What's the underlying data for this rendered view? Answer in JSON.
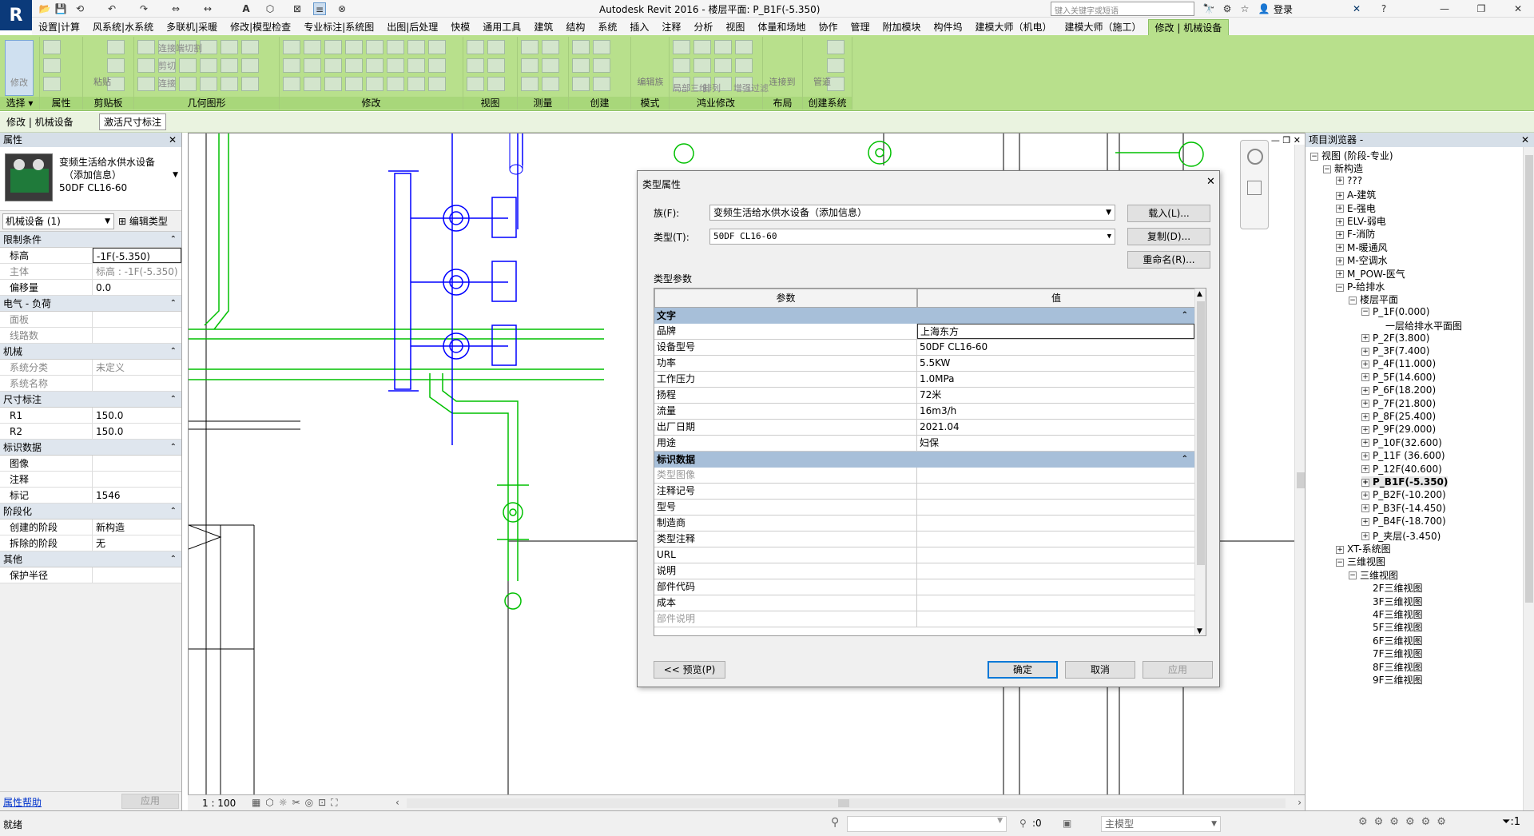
{
  "app": {
    "title": "Autodesk Revit 2016  -  楼层平面: P_B1F(-5.350)",
    "logo": "R",
    "search_placeholder": "键入关键字或短语",
    "login": "登录"
  },
  "ribbon_tabs": [
    "设置|计算",
    "风系统|水系统",
    "多联机|采暖",
    "修改|模型检查",
    "专业标注|系统图",
    "出图|后处理",
    "快模",
    "通用工具",
    "建筑",
    "结构",
    "系统",
    "插入",
    "注释",
    "分析",
    "视图",
    "体量和场地",
    "协作",
    "管理",
    "附加模块",
    "构件坞",
    "建模大师（机电）",
    "建模大师（施工）",
    "修改 | 机械设备"
  ],
  "ribbon_panels": [
    {
      "label": "选择 ▾",
      "btn": "修改"
    },
    {
      "label": "属性"
    },
    {
      "label": "剪贴板",
      "btn": "粘贴"
    },
    {
      "label": "几何图形",
      "items": [
        "连接端切割",
        "剪切",
        "连接"
      ]
    },
    {
      "label": "修改"
    },
    {
      "label": "视图"
    },
    {
      "label": "测量"
    },
    {
      "label": "创建"
    },
    {
      "label": "模式",
      "btn": "编辑族"
    },
    {
      "label": "鸿业修改",
      "items": [
        "局部三维",
        "排列",
        "增强过滤"
      ]
    },
    {
      "label": "布局",
      "btn": "连接到"
    },
    {
      "label": "创建系统",
      "btn": "管道"
    }
  ],
  "options_bar": {
    "context": "修改 | 机械设备",
    "activate_dim": "激活尺寸标注"
  },
  "properties": {
    "header": "属性",
    "family_name": "变频生活给水供水设备",
    "family_sub": "（添加信息）",
    "type_name": "50DF CL16-60",
    "filter": "机械设备 (1)",
    "edit_type": "编辑类型",
    "sections": [
      {
        "name": "限制条件",
        "rows": [
          [
            "标高",
            "-1F(-5.350)",
            false
          ],
          [
            "主体",
            "标高 : -1F(-5.350)",
            true
          ],
          [
            "偏移量",
            "0.0",
            false
          ]
        ]
      },
      {
        "name": "电气 - 负荷",
        "rows": [
          [
            "面板",
            "",
            true
          ],
          [
            "线路数",
            "",
            true
          ]
        ]
      },
      {
        "name": "机械",
        "rows": [
          [
            "系统分类",
            "未定义",
            true
          ],
          [
            "系统名称",
            "",
            true
          ]
        ]
      },
      {
        "name": "尺寸标注",
        "rows": [
          [
            "R1",
            "150.0",
            false
          ],
          [
            "R2",
            "150.0",
            false
          ]
        ]
      },
      {
        "name": "标识数据",
        "rows": [
          [
            "图像",
            "",
            false
          ],
          [
            "注释",
            "",
            false
          ],
          [
            "标记",
            "1546",
            false
          ]
        ]
      },
      {
        "name": "阶段化",
        "rows": [
          [
            "创建的阶段",
            "新构造",
            false
          ],
          [
            "拆除的阶段",
            "无",
            false
          ]
        ]
      },
      {
        "name": "其他",
        "rows": [
          [
            "保护半径",
            "",
            false
          ]
        ]
      }
    ],
    "help": "属性帮助",
    "apply": "应用"
  },
  "view_bar": {
    "scale": "1 : 100"
  },
  "browser": {
    "header": "项目浏览器 -",
    "nodes": [
      {
        "t": "视图 (阶段-专业)",
        "lvl": 0,
        "tg": "−"
      },
      {
        "t": "新构造",
        "lvl": 1,
        "tg": "−"
      },
      {
        "t": "???",
        "lvl": 2,
        "tg": "+"
      },
      {
        "t": "A-建筑",
        "lvl": 2,
        "tg": "+"
      },
      {
        "t": "E-强电",
        "lvl": 2,
        "tg": "+"
      },
      {
        "t": "ELV-弱电",
        "lvl": 2,
        "tg": "+"
      },
      {
        "t": "F-消防",
        "lvl": 2,
        "tg": "+"
      },
      {
        "t": "M-暖通风",
        "lvl": 2,
        "tg": "+"
      },
      {
        "t": "M-空调水",
        "lvl": 2,
        "tg": "+"
      },
      {
        "t": "M_POW-医气",
        "lvl": 2,
        "tg": "+"
      },
      {
        "t": "P-给排水",
        "lvl": 2,
        "tg": "−"
      },
      {
        "t": "楼层平面",
        "lvl": 3,
        "tg": "−"
      },
      {
        "t": "P_1F(0.000)",
        "lvl": 4,
        "tg": "−"
      },
      {
        "t": "一层给排水平面图",
        "lvl": 5,
        "tg": ""
      },
      {
        "t": "P_2F(3.800)",
        "lvl": 4,
        "tg": "+"
      },
      {
        "t": "P_3F(7.400)",
        "lvl": 4,
        "tg": "+"
      },
      {
        "t": "P_4F(11.000)",
        "lvl": 4,
        "tg": "+"
      },
      {
        "t": "P_5F(14.600)",
        "lvl": 4,
        "tg": "+"
      },
      {
        "t": "P_6F(18.200)",
        "lvl": 4,
        "tg": "+"
      },
      {
        "t": "P_7F(21.800)",
        "lvl": 4,
        "tg": "+"
      },
      {
        "t": "P_8F(25.400)",
        "lvl": 4,
        "tg": "+"
      },
      {
        "t": "P_9F(29.000)",
        "lvl": 4,
        "tg": "+"
      },
      {
        "t": "P_10F(32.600)",
        "lvl": 4,
        "tg": "+"
      },
      {
        "t": "P_11F (36.600)",
        "lvl": 4,
        "tg": "+"
      },
      {
        "t": "P_12F(40.600)",
        "lvl": 4,
        "tg": "+"
      },
      {
        "t": "P_B1F(-5.350)",
        "lvl": 4,
        "tg": "+",
        "bold": true
      },
      {
        "t": "P_B2F(-10.200)",
        "lvl": 4,
        "tg": "+"
      },
      {
        "t": "P_B3F(-14.450)",
        "lvl": 4,
        "tg": "+"
      },
      {
        "t": "P_B4F(-18.700)",
        "lvl": 4,
        "tg": "+"
      },
      {
        "t": "P_夹层(-3.450)",
        "lvl": 4,
        "tg": "+"
      },
      {
        "t": "XT-系统图",
        "lvl": 2,
        "tg": "+"
      },
      {
        "t": "三维视图",
        "lvl": 2,
        "tg": "−"
      },
      {
        "t": "三维视图",
        "lvl": 3,
        "tg": "−"
      },
      {
        "t": "2F三维视图",
        "lvl": 4,
        "tg": ""
      },
      {
        "t": "3F三维视图",
        "lvl": 4,
        "tg": ""
      },
      {
        "t": "4F三维视图",
        "lvl": 4,
        "tg": ""
      },
      {
        "t": "5F三维视图",
        "lvl": 4,
        "tg": ""
      },
      {
        "t": "6F三维视图",
        "lvl": 4,
        "tg": ""
      },
      {
        "t": "7F三维视图",
        "lvl": 4,
        "tg": ""
      },
      {
        "t": "8F三维视图",
        "lvl": 4,
        "tg": ""
      },
      {
        "t": "9F三维视图",
        "lvl": 4,
        "tg": ""
      }
    ]
  },
  "status": {
    "text": "就绪",
    "coord": ":0",
    "model": "主模型"
  },
  "dialog": {
    "title": "类型属性",
    "family_label": "族(F):",
    "family_value": "变频生活给水供水设备（添加信息）",
    "type_label": "类型(T):",
    "type_value": "50DF CL16-60",
    "load_btn": "载入(L)...",
    "dup_btn": "复制(D)...",
    "rename_btn": "重命名(R)...",
    "params_label": "类型参数",
    "col_param": "参数",
    "col_value": "值",
    "sections": [
      {
        "name": "文字",
        "rows": [
          [
            "品牌",
            "上海东方",
            false
          ],
          [
            "设备型号",
            "50DF CL16-60",
            false
          ],
          [
            "功率",
            "5.5KW",
            false
          ],
          [
            "工作压力",
            "1.0MPa",
            false
          ],
          [
            "扬程",
            "72米",
            false
          ],
          [
            "流量",
            "16m3/h",
            false
          ],
          [
            "出厂日期",
            "2021.04",
            false
          ],
          [
            "用途",
            "妇保",
            false
          ]
        ]
      },
      {
        "name": "标识数据",
        "rows": [
          [
            "类型图像",
            "",
            true
          ],
          [
            "注释记号",
            "",
            false
          ],
          [
            "型号",
            "",
            false
          ],
          [
            "制造商",
            "",
            false
          ],
          [
            "类型注释",
            "",
            false
          ],
          [
            "URL",
            "",
            false
          ],
          [
            "说明",
            "",
            false
          ],
          [
            "部件代码",
            "",
            false
          ],
          [
            "成本",
            "",
            false
          ],
          [
            "部件说明",
            "",
            true
          ]
        ]
      }
    ],
    "preview_btn": "<< 预览(P)",
    "ok_btn": "确定",
    "cancel_btn": "取消",
    "apply_btn": "应用"
  }
}
